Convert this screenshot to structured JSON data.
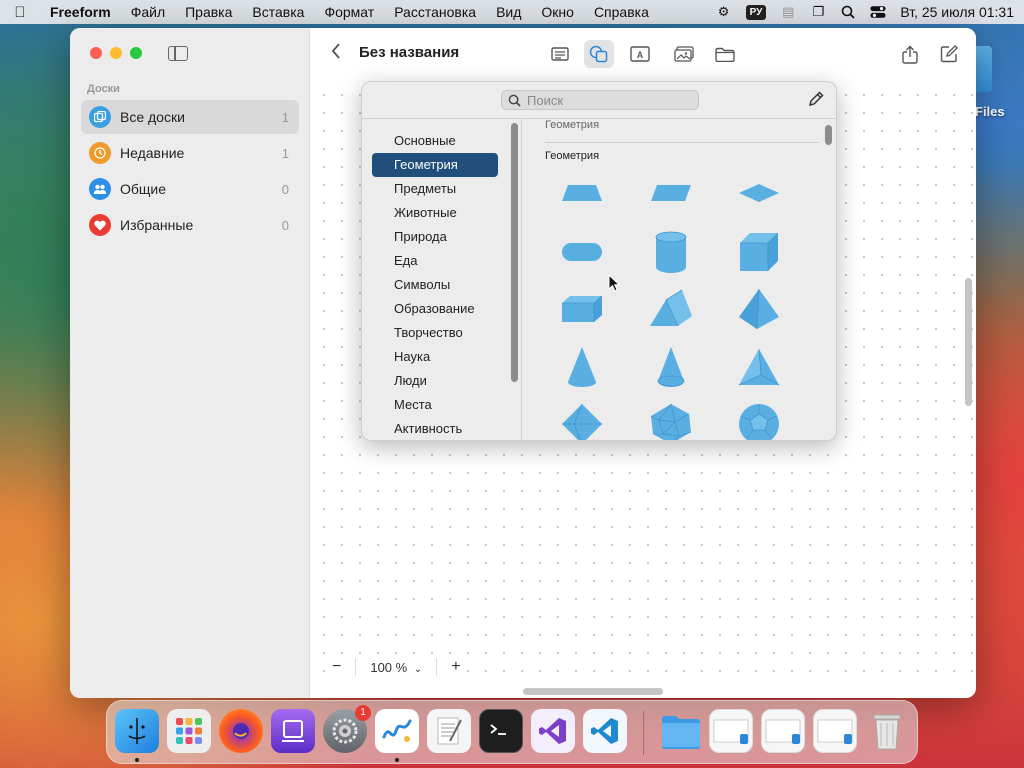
{
  "menubar": {
    "app_name": "Freeform",
    "items": [
      "Файл",
      "Правка",
      "Вставка",
      "Формат",
      "Расстановка",
      "Вид",
      "Окно",
      "Справка"
    ],
    "input_language": "РУ",
    "clock": "Вт, 25 июля  01:31"
  },
  "sidebar": {
    "section_title": "Доски",
    "items": [
      {
        "label": "Все доски",
        "count": "1",
        "icon": "all-boards-icon",
        "color": "#3a9fe0"
      },
      {
        "label": "Недавние",
        "count": "1",
        "icon": "clock-icon",
        "color": "#f09a2a"
      },
      {
        "label": "Общие",
        "count": "0",
        "icon": "people-icon",
        "color": "#2f8fe8"
      },
      {
        "label": "Избранные",
        "count": "0",
        "icon": "heart-icon",
        "color": "#ea3b33"
      }
    ]
  },
  "toolbar": {
    "title": "Без названия"
  },
  "shapes_popover": {
    "search_placeholder": "Поиск",
    "categories": [
      "Основные",
      "Геометрия",
      "Предметы",
      "Животные",
      "Природа",
      "Еда",
      "Символы",
      "Образование",
      "Творчество",
      "Наука",
      "Люди",
      "Места",
      "Активность"
    ],
    "selected_category": "Геометрия",
    "sticky_header": "Геометрия",
    "section_header": "Геометрия",
    "shape_color": "#5aafe2",
    "shapes": [
      "trapezoid",
      "parallelogram",
      "rhombus",
      "stadium",
      "cylinder",
      "cube",
      "cuboid",
      "triangular-prism",
      "pyramid",
      "cone",
      "cone-tall",
      "tetrahedron",
      "octahedron",
      "icosahedron",
      "dodecahedron"
    ]
  },
  "zoom": {
    "minus": "−",
    "value": "100 %",
    "plus": "+"
  },
  "desktop": {
    "files_label": "Files"
  },
  "dock": {
    "apps": [
      "Finder",
      "Launchpad",
      "Firefox",
      "Podcasts Apps",
      "System Settings",
      "Freeform",
      "TextEdit",
      "Terminal",
      "Visual Studio",
      "Visual Studio Code",
      "Downloads",
      "Window 1",
      "Window 2",
      "Window 3",
      "Trash"
    ],
    "settings_badge": "1"
  }
}
